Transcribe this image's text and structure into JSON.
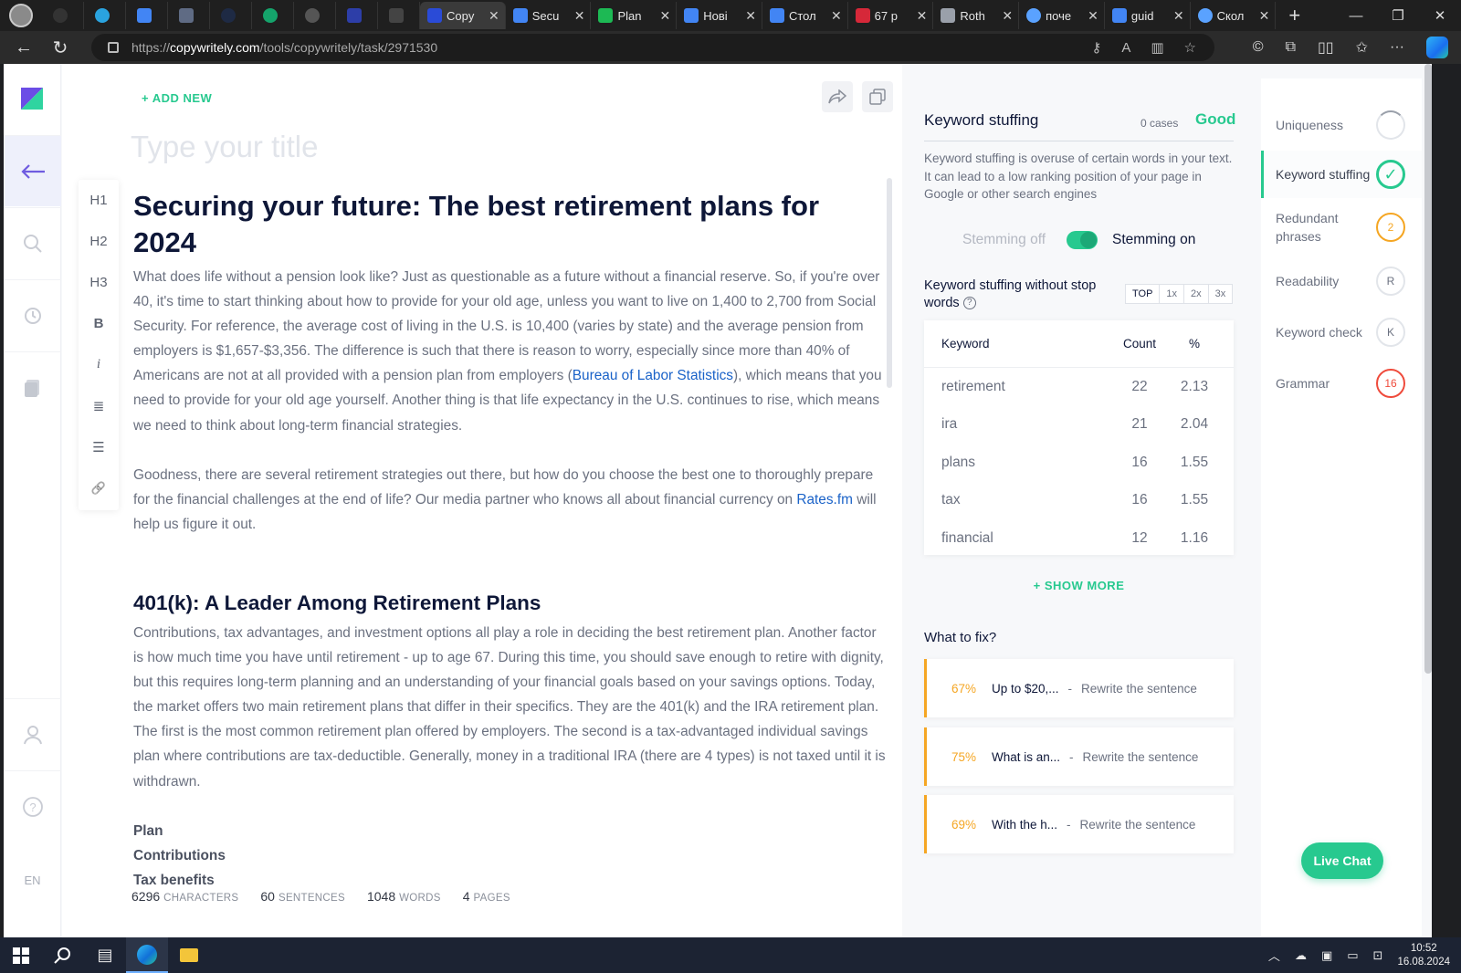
{
  "browser": {
    "tabs": [
      {
        "title": "Copy",
        "color": "#2a4bd7",
        "active": true
      },
      {
        "title": "Secu",
        "color": "#4285f4"
      },
      {
        "title": "Plan",
        "color": "#1db954"
      },
      {
        "title": "Нові",
        "color": "#4285f4"
      },
      {
        "title": "Стол",
        "color": "#4285f4"
      },
      {
        "title": "67 p",
        "color": "#d62839"
      },
      {
        "title": "Roth",
        "color": "#9aa0aa"
      },
      {
        "title": "поче",
        "color": "#5aa2ff"
      },
      {
        "title": "guid",
        "color": "#4285f4"
      },
      {
        "title": "Скол",
        "color": "#5aa2ff"
      }
    ],
    "url_scheme": "https://",
    "url_host": "copywritely.com",
    "url_path": "/tools/copywritely/task/2971530"
  },
  "editor": {
    "add_new": "+ ADD NEW",
    "title_placeholder": "Type your title",
    "formatting": [
      "H1",
      "H2",
      "H3",
      "B",
      "i",
      "≣",
      "☰",
      "🔗"
    ],
    "h1": "Securing your future: The best retirement plans for 2024",
    "p1_a": "What does life without a pension look like? Just as questionable as a future without a financial reserve. So, if you're over 40, it's time to start thinking about how to provide for your old age, unless you want to live on 1,400 to 2,700 from Social Security. For reference, the average cost of living in the U.S. is 10,400 (varies by state) and the average pension from employers is $1,657-$3,356. The difference is such that there is reason to worry, especially since more than 40% of Americans are not at all provided with a pension plan from employers (",
    "p1_link": "Bureau of Labor Statistics",
    "p1_b": "), which means that you need to provide for your old age yourself. Another thing is that life expectancy in the U.S. continues to rise, which means we need to think about long-term financial strategies.",
    "p2_a": "Goodness, there are several retirement strategies out there, but how do you choose the best one to thoroughly prepare for the financial challenges at the end of life? Our media partner who knows all about financial currency on ",
    "p2_link": "Rates.fm",
    "p2_b": " will help us figure it out.",
    "h2": "401(k): A Leader Among Retirement Plans",
    "p3": "Contributions, tax advantages, and investment options all play a role in deciding the best retirement plan. Another factor is how much time you have until retirement - up to age 67. During this time, you should save enough to retire with dignity, but this requires long-term planning and an understanding of your financial goals based on your savings options. Today, the market offers two main retirement plans that differ in their specifics. They are the 401(k) and the IRA retirement plan. The first is the most common retirement plan offered by employers. The second is a tax-advantaged individual savings plan where contributions are tax-deductible. Generally, money in a traditional IRA (there are 4 types) is not taxed until it is withdrawn.",
    "bold_lines": [
      "Plan",
      "Contributions",
      "Tax benefits"
    ],
    "stats": [
      {
        "value": "6296",
        "label": "CHARACTERS"
      },
      {
        "value": "60",
        "label": "SENTENCES"
      },
      {
        "value": "1048",
        "label": "WORDS"
      },
      {
        "value": "4",
        "label": "PAGES"
      }
    ]
  },
  "rail": {
    "lang": "EN"
  },
  "panel": {
    "title": "Keyword stuffing",
    "cases": "0 cases",
    "status": "Good",
    "description": "Keyword stuffing is overuse of certain words in your text. It can lead to a low ranking position of your page in Google or other search engines",
    "stemming_off": "Stemming off",
    "stemming_on": "Stemming on",
    "table_title": "Keyword stuffing without stop words",
    "filters": [
      "TOP",
      "1x",
      "2x",
      "3x"
    ],
    "columns": [
      "Keyword",
      "Count",
      "%"
    ],
    "rows": [
      {
        "keyword": "retirement",
        "count": "22",
        "pct": "2.13"
      },
      {
        "keyword": "ira",
        "count": "21",
        "pct": "2.04"
      },
      {
        "keyword": "plans",
        "count": "16",
        "pct": "1.55"
      },
      {
        "keyword": "tax",
        "count": "16",
        "pct": "1.55"
      },
      {
        "keyword": "financial",
        "count": "12",
        "pct": "1.16"
      }
    ],
    "show_more": "+ SHOW MORE",
    "what_to_fix": "What to fix?",
    "fixes": [
      {
        "pct": "67%",
        "snippet": "Up to $20,...",
        "sep": "-",
        "action": "Rewrite the sentence"
      },
      {
        "pct": "75%",
        "snippet": "What is an...",
        "sep": "-",
        "action": "Rewrite the sentence"
      },
      {
        "pct": "69%",
        "snippet": "With the h...",
        "sep": "-",
        "action": "Rewrite the sentence"
      }
    ]
  },
  "rnav": [
    {
      "label": "Uniqueness",
      "badge": ""
    },
    {
      "label": "Keyword stuffing",
      "badge": "✓"
    },
    {
      "label": "Redundant phrases",
      "badge": "2"
    },
    {
      "label": "Readability",
      "badge": "R"
    },
    {
      "label": "Keyword check",
      "badge": "K"
    },
    {
      "label": "Grammar",
      "badge": "16"
    }
  ],
  "live_chat": "Live Chat",
  "taskbar": {
    "time": "10:52",
    "date": "16.08.2024"
  },
  "colors": {
    "accent_green": "#27c98f",
    "warning_orange": "#f5a623",
    "error_red": "#ef4b3c",
    "heading_navy": "#0e1738",
    "link_blue": "#1a62c8"
  }
}
